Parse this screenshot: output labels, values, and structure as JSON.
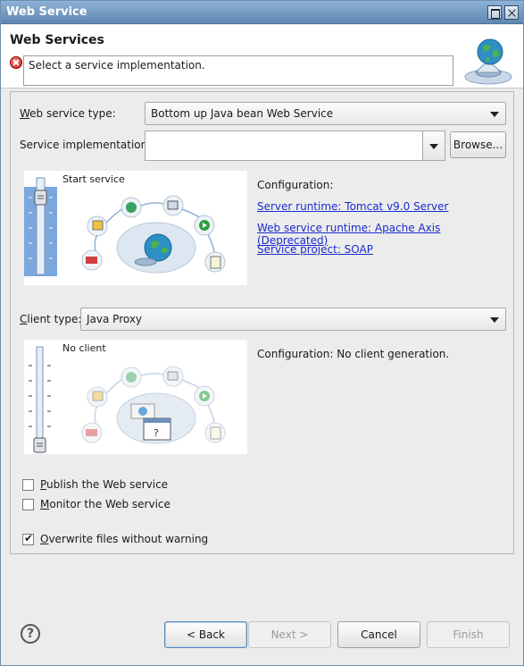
{
  "window": {
    "title": "Web Service"
  },
  "header": {
    "title": "Web Services",
    "message": "Select a service implementation."
  },
  "service": {
    "type_label_prefix": "W",
    "type_label_rest": "eb service type:",
    "type_value": "Bottom up Java bean Web Service",
    "impl_label": "Service implementation:",
    "impl_value": "",
    "browse_label": "Browse...",
    "slider_caption": "Start service",
    "config_label": "Configuration:",
    "links": [
      "Server runtime: Tomcat v9.0 Server",
      "Web service runtime: Apache Axis (Deprecated)",
      "Service project: SOAP"
    ]
  },
  "client": {
    "type_label_prefix": "C",
    "type_label_rest": "lient type:",
    "type_value": "Java Proxy",
    "slider_caption": "No client",
    "config_label": "Configuration: No client generation."
  },
  "options": [
    {
      "prefix": "P",
      "rest": "ublish the Web service",
      "checked": false
    },
    {
      "prefix": "M",
      "rest": "onitor the Web service",
      "checked": false
    },
    {
      "prefix": "O",
      "rest": "verwrite files without warning",
      "checked": true
    }
  ],
  "buttons": {
    "back": "< Back",
    "next": "Next >",
    "cancel": "Cancel",
    "finish": "Finish"
  },
  "icons": {
    "help": "help-icon",
    "error": "error-icon",
    "globe": "globe-icon"
  }
}
